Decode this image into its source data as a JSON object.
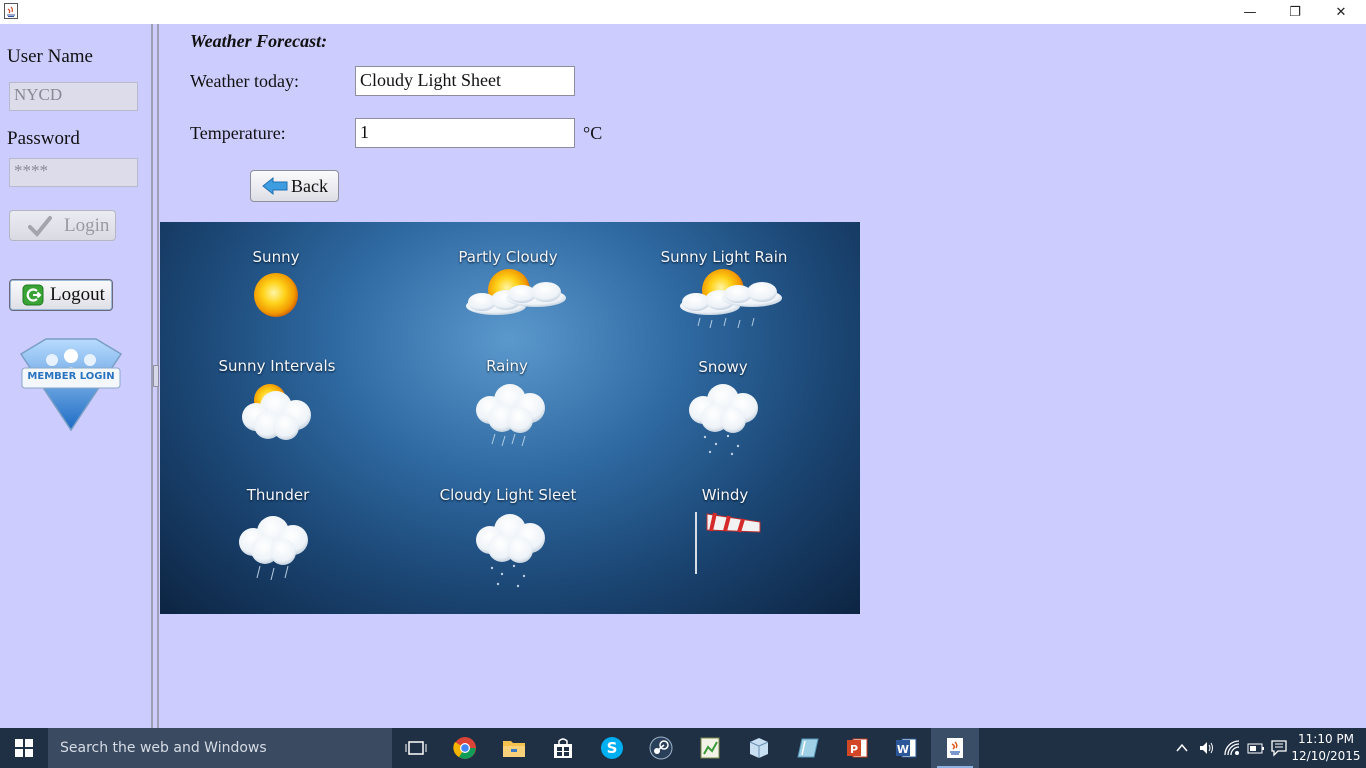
{
  "window": {
    "minimize_glyph": "—",
    "restore_glyph": "❐",
    "close_glyph": "✕"
  },
  "sidebar": {
    "username_label": "User Name",
    "username_value": "NYCD",
    "password_label": "Password",
    "password_value": "****",
    "login_label": "Login",
    "logout_label": "Logout",
    "member_login_text": "MEMBER LOGIN"
  },
  "main": {
    "title": "Weather Forecast:",
    "weather_label": "Weather today:",
    "weather_value": "Cloudy Light Sheet",
    "temperature_label": "Temperature:",
    "temperature_value": "1",
    "temperature_unit": "°C",
    "back_label": "Back"
  },
  "weather_chart": {
    "labels": [
      "Sunny",
      "Partly Cloudy",
      "Sunny Light Rain",
      "Sunny Intervals",
      "Rainy",
      "Snowy",
      "Thunder",
      "Cloudy Light Sleet",
      "Windy"
    ]
  },
  "taskbar": {
    "search_placeholder": "Search the web and Windows",
    "apps": [
      "task-view",
      "chrome",
      "file-explorer",
      "store",
      "skype",
      "steam",
      "sheet-app",
      "cube-app",
      "glass-app",
      "powerpoint",
      "word",
      "java"
    ],
    "time": "11:10 PM",
    "date": "12/10/2015"
  },
  "colors": {
    "background": "#ccccff",
    "taskbar": "#1f2f44",
    "accent_blue": "#3d8fd6"
  }
}
